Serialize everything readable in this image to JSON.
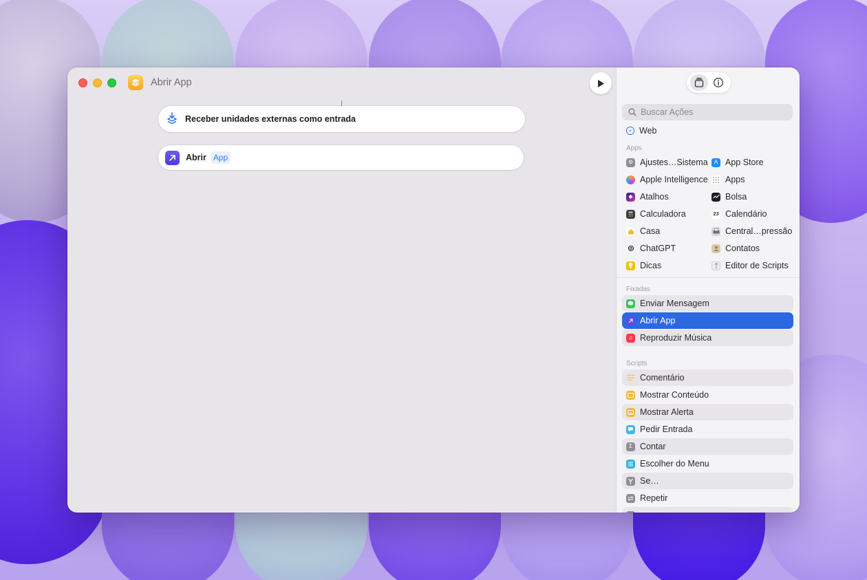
{
  "window": {
    "title": "Abrir App"
  },
  "editor": {
    "input_action": "Receber unidades externas como entrada",
    "open_action": {
      "verb": "Abrir",
      "parameter": "App"
    }
  },
  "sidebar": {
    "search_placeholder": "Buscar Ações",
    "web_label": "Web",
    "apps_label": "Apps",
    "apps": [
      {
        "label": "Ajustes…Sistema",
        "icon": "gear-icon",
        "color": "#8e8e93"
      },
      {
        "label": "App Store",
        "icon": "app-store-icon",
        "color": "#1c8ef9"
      },
      {
        "label": "Apple Intelligence",
        "icon": "apple-intelligence-icon",
        "color": "#e3629a"
      },
      {
        "label": "Apps",
        "icon": "grid-icon",
        "color": "#b8b6bb"
      },
      {
        "label": "Atalhos",
        "icon": "shortcuts-icon",
        "color": "#6a3fd8"
      },
      {
        "label": "Bolsa",
        "icon": "stocks-icon",
        "color": "#1c1c1e"
      },
      {
        "label": "Calculadora",
        "icon": "calculator-icon",
        "color": "#3a3a3c"
      },
      {
        "label": "Calendário",
        "icon": "calendar-icon",
        "color": "#ffffff"
      },
      {
        "label": "Casa",
        "icon": "home-icon",
        "color": "#f7b733"
      },
      {
        "label": "Central…pressão",
        "icon": "printer-icon",
        "color": "#6e6e73"
      },
      {
        "label": "ChatGPT",
        "icon": "chatgpt-icon",
        "color": "#ececec"
      },
      {
        "label": "Contatos",
        "icon": "contacts-icon",
        "color": "#c9b99a"
      },
      {
        "label": "Dicas",
        "icon": "tips-icon",
        "color": "#f5c000"
      },
      {
        "label": "Editor de Scripts",
        "icon": "script-editor-icon",
        "color": "#e9e9ea"
      }
    ],
    "calendar_day": "23",
    "pinned_label": "Fixadas",
    "pinned": [
      {
        "label": "Enviar Mensagem",
        "icon": "messages-icon",
        "color": "#34c759"
      },
      {
        "label": "Abrir App",
        "icon": "open-app-icon",
        "color": "#5b4ce8"
      },
      {
        "label": "Reproduzir Música",
        "icon": "music-icon",
        "color": "#fa3c4c"
      }
    ],
    "scripts_label": "Scripts",
    "scripts": [
      {
        "label": "Comentário",
        "icon": "comment-icon",
        "color": "#f6c343"
      },
      {
        "label": "Mostrar Conteúdo",
        "icon": "show-content-icon",
        "color": "#f6b73c"
      },
      {
        "label": "Mostrar Alerta",
        "icon": "alert-icon",
        "color": "#f6b73c"
      },
      {
        "label": "Pedir Entrada",
        "icon": "ask-input-icon",
        "color": "#3cb8e6"
      },
      {
        "label": "Contar",
        "icon": "count-icon",
        "color": "#8e8e93"
      },
      {
        "label": "Escolher do Menu",
        "icon": "menu-icon",
        "color": "#34b4e4"
      },
      {
        "label": "Se…",
        "icon": "if-icon",
        "color": "#8e8e93"
      },
      {
        "label": "Repetir",
        "icon": "repeat-icon",
        "color": "#8e8e93"
      }
    ]
  }
}
